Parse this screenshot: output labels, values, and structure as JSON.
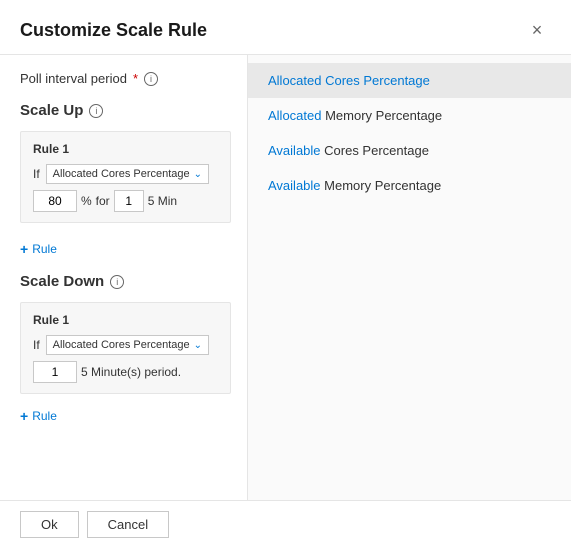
{
  "modal": {
    "title": "Customize Scale Rule",
    "close_label": "×"
  },
  "left": {
    "poll_interval_label": "Poll interval period",
    "required_indicator": "*",
    "sections": {
      "scale_up": {
        "title": "Scale Up",
        "rule1_label": "Rule 1",
        "if_label": "If",
        "dropdown_value": "Allocated Cores Percentage",
        "value": "80",
        "pct_label": "%",
        "for_label": "for",
        "min_value": "1",
        "min_label": "5 Min",
        "add_rule_label": "Rule"
      },
      "scale_down": {
        "title": "Scale Down",
        "rule1_label": "Rule 1",
        "if_label": "If",
        "dropdown_value": "Allocated Cores Percentage",
        "value": "1",
        "period_text": "5 Minute(s) period.",
        "add_rule_label": "Rule"
      }
    }
  },
  "right": {
    "items": [
      {
        "label": "Allocated Cores Percentage",
        "selected": true,
        "highlight_word": ""
      },
      {
        "label": "Allocated Memory Percentage",
        "selected": false,
        "highlight_word": "Allocated"
      },
      {
        "label": "Available Cores Percentage",
        "selected": false,
        "highlight_word": "Available"
      },
      {
        "label": "Available Memory Percentage",
        "selected": false,
        "highlight_word": "Available"
      }
    ]
  },
  "footer": {
    "ok_label": "Ok",
    "cancel_label": "Cancel"
  }
}
